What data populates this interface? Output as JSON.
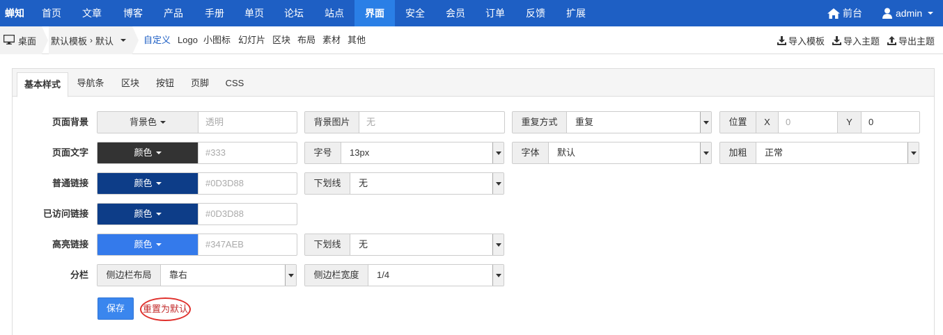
{
  "topnav": {
    "brand": "蝉知",
    "items": [
      "首页",
      "文章",
      "博客",
      "产品",
      "手册",
      "单页",
      "论坛",
      "站点",
      "界面",
      "安全",
      "会员",
      "订单",
      "反馈",
      "扩展"
    ],
    "active_index": 8,
    "front_label": "前台",
    "user_label": "admin",
    "bg_color": "#1E5FC4",
    "active_color": "#2A7FE6"
  },
  "subbar": {
    "desktop_label": "桌面",
    "template_label": "默认模板",
    "theme_label": "默认",
    "links": [
      "自定义",
      "Logo",
      "小图标",
      "幻灯片",
      "区块",
      "布局",
      "素材",
      "其他"
    ],
    "active_link": "自定义",
    "import_template": "导入模板",
    "import_theme": "导入主题",
    "export_theme": "导出主题"
  },
  "tabs": [
    "基本样式",
    "导航条",
    "区块",
    "按钮",
    "页脚",
    "CSS"
  ],
  "form": {
    "page_bg": {
      "label": "页面背景",
      "color_btn": "背景色",
      "color_placeholder": "透明",
      "image_label": "背景图片",
      "image_placeholder": "无",
      "repeat_label": "重复方式",
      "repeat_value": "重复",
      "position_label": "位置",
      "x_label": "X",
      "x_placeholder": "0",
      "y_label": "Y",
      "y_value": "0"
    },
    "page_text": {
      "label": "页面文字",
      "color_btn": "颜色",
      "color_placeholder": "#333",
      "swatch": "#333333",
      "size_label": "字号",
      "size_value": "13px",
      "font_label": "字体",
      "font_value": "默认",
      "bold_label": "加粗",
      "bold_value": "正常"
    },
    "link": {
      "label": "普通链接",
      "color_btn": "颜色",
      "color_placeholder": "#0D3D88",
      "swatch": "#0D3D88",
      "underline_label": "下划线",
      "underline_value": "无"
    },
    "visited": {
      "label": "已访问链接",
      "color_btn": "颜色",
      "color_placeholder": "#0D3D88",
      "swatch": "#0D3D88"
    },
    "highlight": {
      "label": "高亮链接",
      "color_btn": "颜色",
      "color_placeholder": "#347AEB",
      "swatch": "#347AEB",
      "underline_label": "下划线",
      "underline_value": "无"
    },
    "sidebar": {
      "label": "分栏",
      "layout_label": "侧边栏布局",
      "layout_value": "靠右",
      "width_label": "侧边栏宽度",
      "width_value": "1/4"
    },
    "save_label": "保存",
    "reset_label": "重置为默认"
  }
}
